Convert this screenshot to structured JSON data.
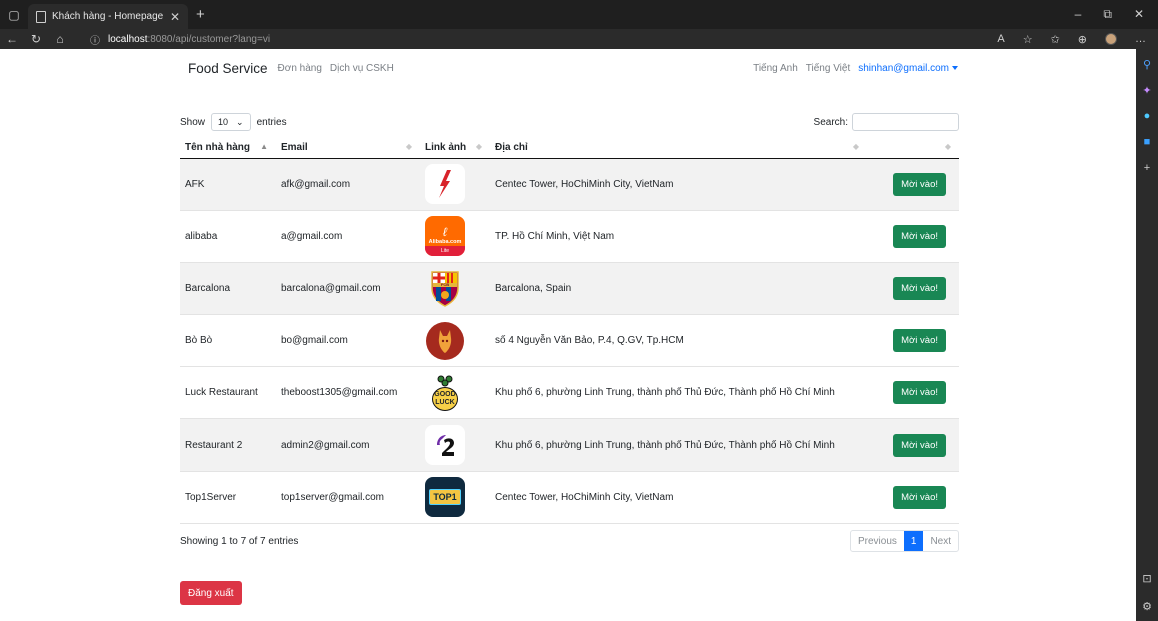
{
  "browser": {
    "tab_title": "Khách hàng - Homepage",
    "url_host": "localhost",
    "url_path": ":8080/api/customer?lang=vi"
  },
  "navbar": {
    "brand": "Food Service",
    "links": [
      "Đơn hàng",
      "Dịch vụ CSKH"
    ],
    "lang_en": "Tiếng Anh",
    "lang_vi": "Tiếng Việt",
    "user_email": "shinhan@gmail.com"
  },
  "datatable": {
    "show_label": "Show",
    "length_value": "10",
    "entries_label": "entries",
    "search_label": "Search:",
    "headers": [
      "Tên nhà hàng",
      "Email",
      "Link ảnh",
      "Địa chỉ",
      ""
    ],
    "rows": [
      {
        "name": "AFK",
        "email": "afk@gmail.com",
        "logo": "afk-logo",
        "address": "Centec Tower, HoChiMinh City, VietNam",
        "action": "Mời vào!"
      },
      {
        "name": "alibaba",
        "email": "a@gmail.com",
        "logo": "alibaba-logo",
        "address": "TP. Hồ Chí Minh, Việt Nam",
        "action": "Mời vào!"
      },
      {
        "name": "Barcalona",
        "email": "barcalona@gmail.com",
        "logo": "barcelona-logo",
        "address": "Barcalona, Spain",
        "action": "Mời vào!"
      },
      {
        "name": "Bò Bò",
        "email": "bo@gmail.com",
        "logo": "bobo-logo",
        "address": "số 4 Nguyễn Văn Bảo, P.4, Q.GV, Tp.HCM",
        "action": "Mời vào!"
      },
      {
        "name": "Luck Restaurant",
        "email": "theboost1305@gmail.com",
        "logo": "goodluck-logo",
        "address": "Khu phố 6, phường Linh Trung, thành phố Thủ Đức, Thành phố Hồ Chí Minh",
        "action": "Mời vào!"
      },
      {
        "name": "Restaurant 2",
        "email": "admin2@gmail.com",
        "logo": "restaurant2-logo",
        "address": "Khu phố 6, phường Linh Trung, thành phố Thủ Đức, Thành phố Hồ Chí Minh",
        "action": "Mời vào!"
      },
      {
        "name": "Top1Server",
        "email": "top1server@gmail.com",
        "logo": "top1-logo",
        "address": "Centec Tower, HoChiMinh City, VietNam",
        "action": "Mời vào!"
      }
    ],
    "info": "Showing 1 to 7 of 7 entries",
    "pager": {
      "previous": "Previous",
      "current": "1",
      "next": "Next"
    }
  },
  "logout_label": "Đăng xuất",
  "logo_text": {
    "alibaba_brand": "Alibaba.com",
    "alibaba_sub": "Lite",
    "barca": "FCB",
    "good": "GOOD",
    "luck": "LUCK",
    "top1": "TOP1"
  },
  "colors": {
    "primary": "#0d6efd",
    "success": "#198754",
    "danger": "#dc3545",
    "stripe": "#f2f2f2"
  }
}
